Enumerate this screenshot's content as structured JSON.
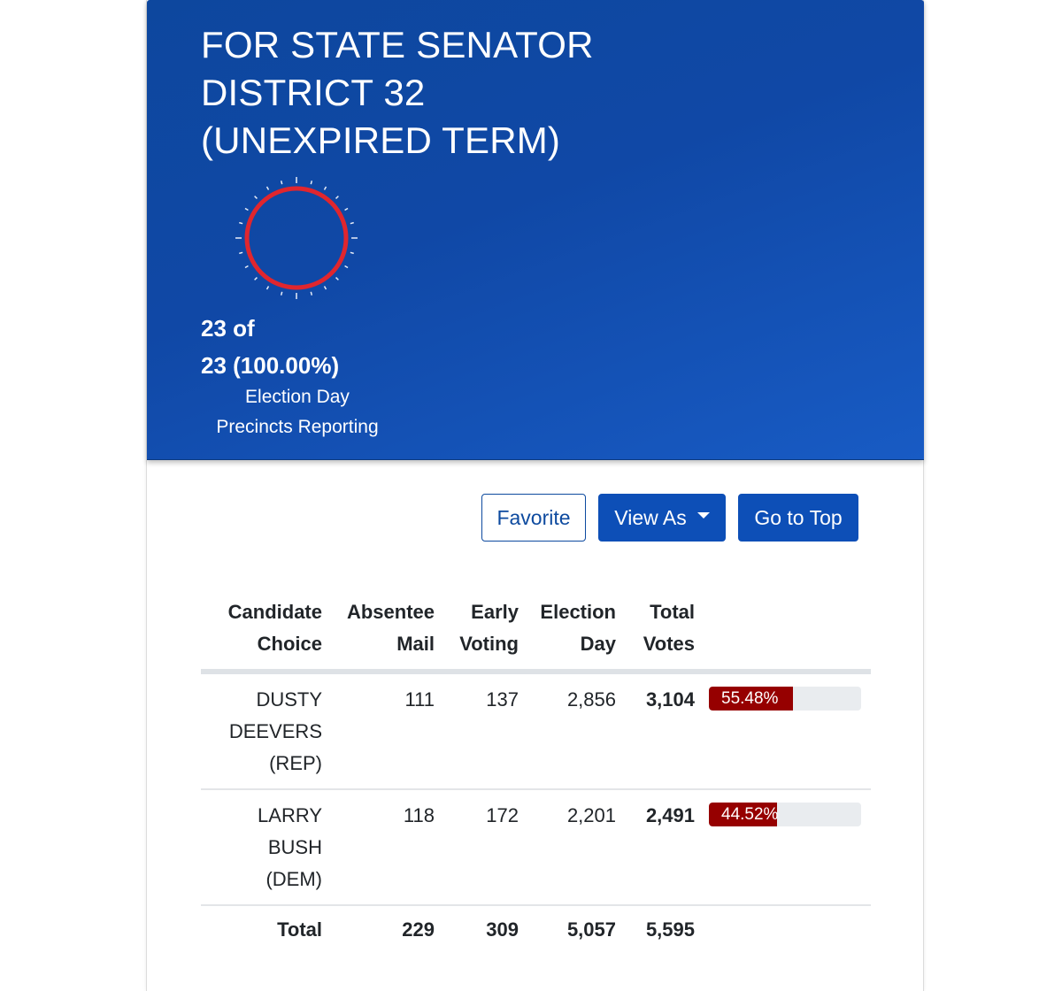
{
  "race": {
    "title_lines": [
      "FOR STATE SENATOR",
      "DISTRICT 32",
      "(UNEXPIRED TERM)"
    ],
    "precincts": {
      "reported": 23,
      "total": 23,
      "line1": "23 of",
      "line2": "23 (100.00%)",
      "caption_line1": "Election Day",
      "caption_line2": "Precincts Reporting",
      "fraction_reporting": 1.0
    },
    "colors": {
      "header_blue": "#0d479e",
      "gauge_ring": "#e0262e",
      "bar_fill": "#960000",
      "button_blue": "#0d4fb7"
    }
  },
  "actions": {
    "favorite_label": "Favorite",
    "view_as_label": "View As",
    "go_to_top_label": "Go to Top"
  },
  "table": {
    "headers": {
      "candidate": [
        "Candidate",
        "Choice"
      ],
      "absentee": [
        "Absentee",
        "Mail"
      ],
      "early": [
        "Early",
        "Voting"
      ],
      "election_day": [
        "Election",
        "Day"
      ],
      "total": [
        "Total",
        "Votes"
      ]
    },
    "rows": [
      {
        "name_lines": [
          "DUSTY",
          "DEEVERS",
          "(REP)"
        ],
        "absentee": "111",
        "early": "137",
        "election_day": "2,856",
        "total": "3,104",
        "percent_label": "55.48%",
        "percent": 55.48
      },
      {
        "name_lines": [
          "LARRY",
          "BUSH",
          "(DEM)"
        ],
        "absentee": "118",
        "early": "172",
        "election_day": "2,201",
        "total": "2,491",
        "percent_label": "44.52%",
        "percent": 44.52
      }
    ],
    "totals": {
      "label": "Total",
      "absentee": "229",
      "early": "309",
      "election_day": "5,057",
      "total": "5,595"
    }
  }
}
